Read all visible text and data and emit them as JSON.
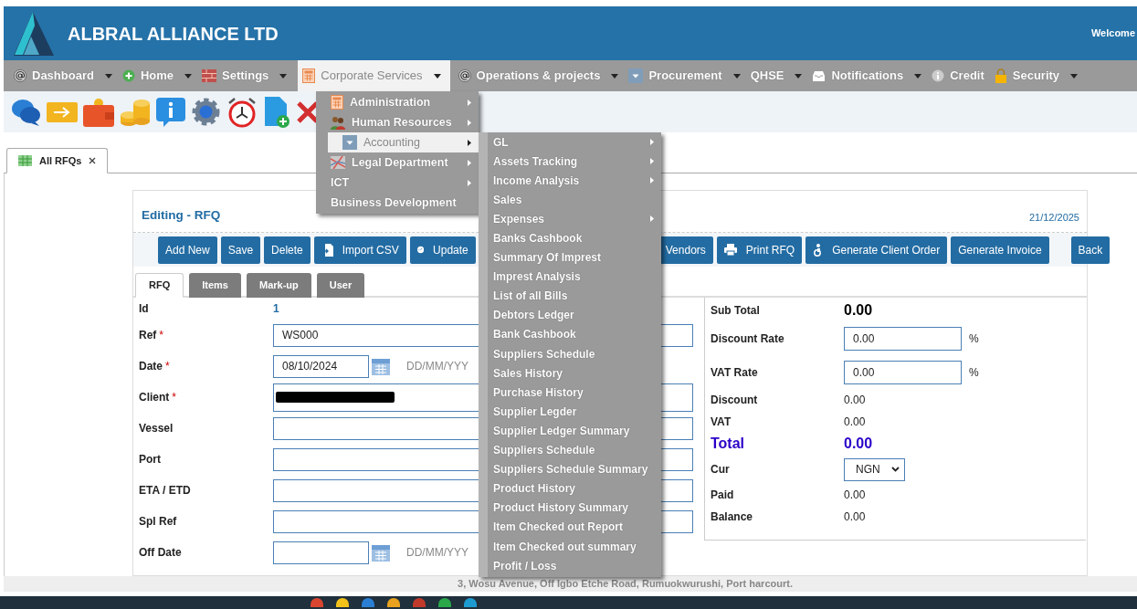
{
  "header": {
    "title": "ALBRAL ALLIANCE LTD",
    "welcome": "Welcome"
  },
  "nav": [
    {
      "label": "Dashboard",
      "kind": "at",
      "caret": true,
      "selected": false
    },
    {
      "label": "Home",
      "kind": "plus",
      "caret": true,
      "selected": false
    },
    {
      "label": "Settings",
      "kind": "bricks",
      "caret": true,
      "selected": false
    },
    {
      "label": "Corporate Services",
      "kind": "calculator",
      "caret": true,
      "selected": true
    },
    {
      "label": "Operations & projects",
      "kind": "at",
      "caret": true,
      "selected": false
    },
    {
      "label": "Procurement",
      "kind": "dropdown",
      "caret": true,
      "selected": false
    },
    {
      "label": "QHSE",
      "kind": "plain",
      "caret": true,
      "selected": false
    },
    {
      "label": "Notifications",
      "kind": "inbox",
      "caret": true,
      "selected": false
    },
    {
      "label": "Credit",
      "kind": "info",
      "caret": false,
      "selected": false
    },
    {
      "label": "Security",
      "kind": "lock",
      "caret": true,
      "selected": false
    }
  ],
  "corporate_menu": [
    {
      "label": "Administration",
      "kind": "calculator",
      "has_submenu": true,
      "selected": false
    },
    {
      "label": "Human Resources",
      "kind": "people",
      "has_submenu": true,
      "selected": false
    },
    {
      "label": "Accounting",
      "kind": "dropdown",
      "has_submenu": true,
      "selected": true
    },
    {
      "label": "Legal Department",
      "kind": "map",
      "has_submenu": true,
      "selected": false
    },
    {
      "label": "ICT",
      "kind": "plain",
      "has_submenu": true,
      "selected": false
    },
    {
      "label": "Business Development",
      "kind": "plain",
      "has_submenu": false,
      "selected": false
    }
  ],
  "accounting_menu": [
    {
      "label": "GL",
      "has_submenu": true
    },
    {
      "label": "Assets Tracking",
      "has_submenu": true
    },
    {
      "label": "Income Analysis",
      "has_submenu": true
    },
    {
      "label": "Sales",
      "has_submenu": false
    },
    {
      "label": "Expenses",
      "has_submenu": true
    },
    {
      "label": "Banks Cashbook",
      "has_submenu": false
    },
    {
      "label": "Summary Of Imprest",
      "has_submenu": false
    },
    {
      "label": "Imprest Analysis",
      "has_submenu": false
    },
    {
      "label": "List of all Bills",
      "has_submenu": false
    },
    {
      "label": "Debtors Ledger",
      "has_submenu": false
    },
    {
      "label": "Bank Cashbook",
      "has_submenu": false
    },
    {
      "label": "Suppliers Schedule",
      "has_submenu": false
    },
    {
      "label": "Sales History",
      "has_submenu": false
    },
    {
      "label": "Purchase History",
      "has_submenu": false
    },
    {
      "label": "Supplier Legder",
      "has_submenu": false
    },
    {
      "label": "Supplier Ledger Summary",
      "has_submenu": false
    },
    {
      "label": "Suppliers Schedule",
      "has_submenu": false
    },
    {
      "label": "Suppliers Schedule Summary",
      "has_submenu": false
    },
    {
      "label": "Product History",
      "has_submenu": false
    },
    {
      "label": "Product History Summary",
      "has_submenu": false
    },
    {
      "label": "Item Checked out Report",
      "has_submenu": false
    },
    {
      "label": "Item Checked out summary",
      "has_submenu": false
    },
    {
      "label": "Profit / Loss",
      "has_submenu": false
    }
  ],
  "doc_tabs": [
    {
      "label": "All RFQs",
      "selected": true
    }
  ],
  "panel": {
    "title": "Editing - RFQ",
    "date": "21/12/2025"
  },
  "actions": [
    {
      "label": "Add New",
      "kind": "plain"
    },
    {
      "label": "Save",
      "kind": "plain"
    },
    {
      "label": "Delete",
      "kind": "plain"
    },
    {
      "label": "Import CSV",
      "kind": "import"
    },
    {
      "label": "Update",
      "kind": "gauge"
    },
    {
      "label": "Vendors",
      "kind": "plain"
    },
    {
      "label": "Print RFQ",
      "kind": "print"
    },
    {
      "label": "Generate Client Order",
      "kind": "person"
    },
    {
      "label": "Generate Invoice",
      "kind": "plain"
    },
    {
      "label": "Back",
      "kind": "plain"
    }
  ],
  "form_tabs": [
    {
      "label": "RFQ",
      "selected": true
    },
    {
      "label": "Items",
      "selected": false
    },
    {
      "label": "Mark-up",
      "selected": false
    },
    {
      "label": "User",
      "selected": false
    }
  ],
  "form": [
    {
      "label": "Id",
      "kind": "value",
      "value": "1"
    },
    {
      "label": "Ref",
      "required_mark": "*",
      "kind": "text",
      "value": "WS000"
    },
    {
      "label": "Date",
      "required_mark": "*",
      "kind": "date",
      "value": "08/10/2024",
      "hint": "DD/MM/YYY"
    },
    {
      "label": "Client",
      "required_mark": "*",
      "kind": "redacted"
    },
    {
      "label": "Vessel",
      "kind": "text"
    },
    {
      "label": "Port",
      "kind": "text"
    },
    {
      "label": "ETA / ETD",
      "kind": "text"
    },
    {
      "label": "Spl Ref",
      "kind": "text"
    },
    {
      "label": "Off Date",
      "kind": "date",
      "hint": "DD/MM/YYY"
    }
  ],
  "summary": [
    {
      "label": "Sub Total",
      "kind": "strong",
      "value": "0.00"
    },
    {
      "label": "Discount Rate",
      "kind": "input",
      "value": "0.00",
      "suffix": "%"
    },
    {
      "label": "VAT Rate",
      "kind": "input",
      "value": "0.00",
      "suffix": "%"
    },
    {
      "label": "Discount",
      "kind": "plain",
      "value": "0.00"
    },
    {
      "label": "VAT",
      "kind": "plain",
      "value": "0.00"
    },
    {
      "label": "Total",
      "kind": "total",
      "value": "0.00"
    },
    {
      "label": "Cur",
      "kind": "select",
      "value": "NGN"
    },
    {
      "label": "Paid",
      "kind": "plain",
      "value": "0.00"
    },
    {
      "label": "Balance",
      "kind": "plain",
      "value": "0.00"
    }
  ],
  "footer": "3, Wosu Avenue, Off Igbo Etche Road, Rumuokwurushi, Port harcourt."
}
